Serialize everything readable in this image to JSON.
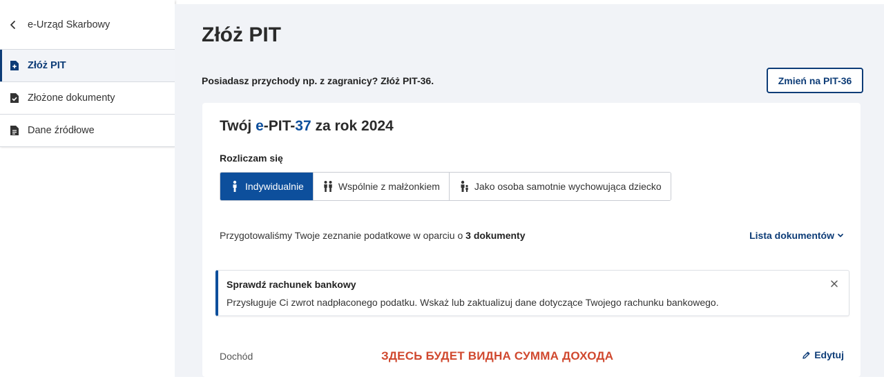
{
  "sidebar": {
    "back_label": "e-Urząd Skarbowy",
    "items": [
      {
        "label": "Złóż PIT",
        "icon": "file-plus-icon",
        "active": true
      },
      {
        "label": "Złożone dokumenty",
        "icon": "file-check-icon",
        "active": false
      },
      {
        "label": "Dane źródłowe",
        "icon": "file-text-icon",
        "active": false
      }
    ]
  },
  "main": {
    "title": "Złóż PIT",
    "foreign_income_text": "Posiadasz przychody np. z zagranicy? Złóż PIT-36.",
    "switch_button": "Zmień na PIT-36"
  },
  "card": {
    "title_prefix": "Twój ",
    "title_e": "e",
    "title_mid": "-PIT-",
    "title_number": "37",
    "title_suffix": " za rok 2024",
    "settle_label": "Rozliczam się",
    "options": [
      {
        "label": "Indywidualnie",
        "icon": "person-icon",
        "selected": true
      },
      {
        "label": "Wspólnie z małżonkiem",
        "icon": "couple-icon",
        "selected": false
      },
      {
        "label": "Jako osoba samotnie wychowująca dziecko",
        "icon": "parent-child-icon",
        "selected": false
      }
    ],
    "prepared_text": "Przygotowaliśmy Twoje zeznanie podatkowe w oparciu o ",
    "prepared_count": "3 dokumenty",
    "doc_list_label": "Lista dokumentów",
    "alert": {
      "title": "Sprawdź rachunek bankowy",
      "body": "Przysługuje Ci zwrot nadpłaconego podatku. Wskaż lub zaktualizuj dane dotyczące Twojego rachunku bankowego."
    },
    "income_label": "Dochód",
    "income_note": "ЗДЕСЬ БУДЕТ ВИДНА СУММА ДОХОДА",
    "edit_label": "Edytuj"
  },
  "colors": {
    "brand": "#0d3c77",
    "accent": "#0d4f9c",
    "note": "#d0482e"
  }
}
